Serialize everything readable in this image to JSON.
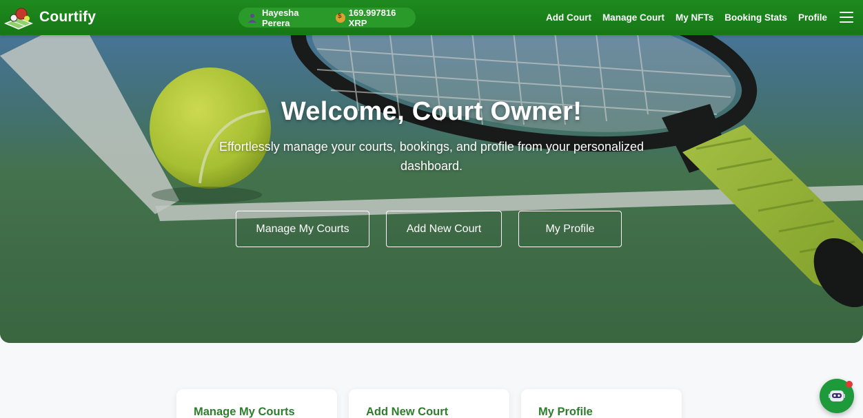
{
  "app": {
    "brand": "Courtify"
  },
  "user": {
    "name": "Hayesha Perera",
    "balance": "169.997816 XRP"
  },
  "nav": {
    "links": [
      "Add Court",
      "Manage Court",
      "My NFTs",
      "Booking Stats",
      "Profile"
    ]
  },
  "hero": {
    "title": "Welcome, Court Owner!",
    "subtitle": "Effortlessly manage your courts, bookings, and profile from your personalized dashboard.",
    "buttons": [
      "Manage My Courts",
      "Add New Court",
      "My Profile"
    ]
  },
  "cards": [
    {
      "title": "Manage My Courts"
    },
    {
      "title": "Add New Court"
    },
    {
      "title": "My Profile"
    }
  ],
  "icons": {
    "logo": "courtify-logo",
    "user": "user-icon",
    "balance": "money-bag-icon",
    "menu": "hamburger-menu-icon",
    "chat": "chatbot-icon"
  },
  "colors": {
    "primary": "#1e8a1e",
    "card_title": "#2d7d2d",
    "chat_button": "#1f9a3a"
  }
}
